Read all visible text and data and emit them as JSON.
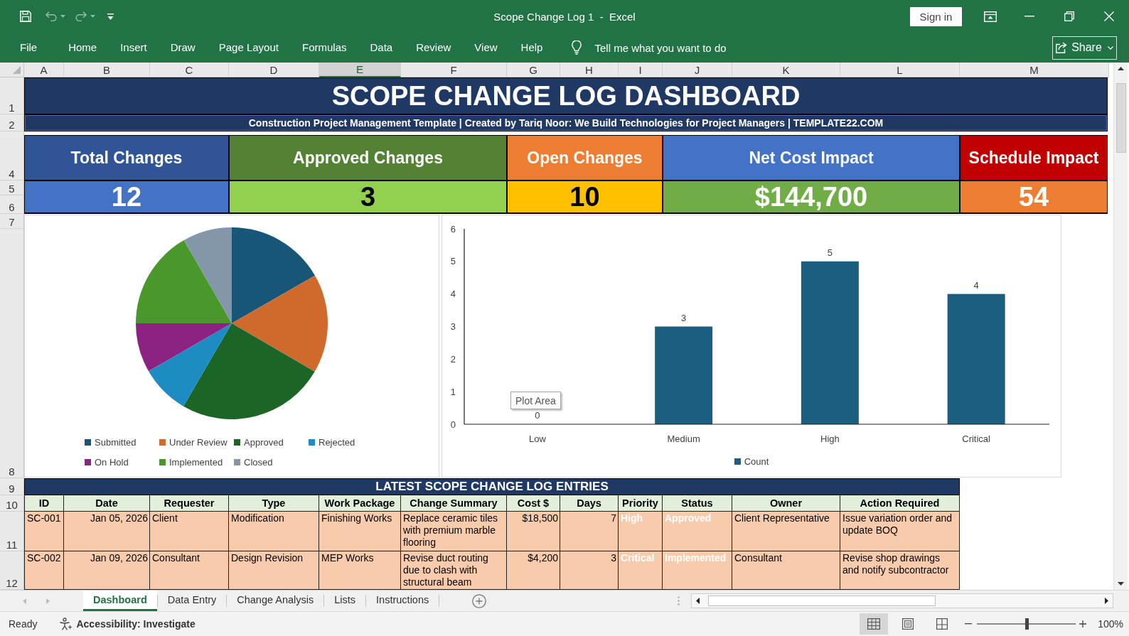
{
  "window": {
    "title": "Scope Change Log 1  -  Excel",
    "sign_in": "Sign in"
  },
  "ribbon": {
    "tabs": [
      {
        "label": "File",
        "selected": false
      },
      {
        "label": "Home",
        "selected": false
      },
      {
        "label": "Insert",
        "selected": false
      },
      {
        "label": "Draw",
        "selected": false
      },
      {
        "label": "Page Layout",
        "selected": false
      },
      {
        "label": "Formulas",
        "selected": false
      },
      {
        "label": "Data",
        "selected": false
      },
      {
        "label": "Review",
        "selected": false
      },
      {
        "label": "View",
        "selected": false
      },
      {
        "label": "Help",
        "selected": false
      }
    ],
    "tell_me": "Tell me what you want to do",
    "share": "Share"
  },
  "sheet": {
    "columns": [
      {
        "label": "A",
        "selected": false
      },
      {
        "label": "B",
        "selected": false
      },
      {
        "label": "C",
        "selected": false
      },
      {
        "label": "D",
        "selected": false
      },
      {
        "label": "E",
        "selected": true
      },
      {
        "label": "F",
        "selected": false
      },
      {
        "label": "G",
        "selected": false
      },
      {
        "label": "H",
        "selected": false
      },
      {
        "label": "I",
        "selected": false
      },
      {
        "label": "J",
        "selected": false
      },
      {
        "label": "K",
        "selected": false
      },
      {
        "label": "L",
        "selected": false
      },
      {
        "label": "M",
        "selected": false
      }
    ],
    "rows": [
      "1",
      "2",
      "4",
      "5",
      "6",
      "7",
      "8",
      "9",
      "10",
      "11",
      "12"
    ]
  },
  "header": {
    "title": "SCOPE CHANGE LOG DASHBOARD",
    "subtitle": "Construction Project Management Template | Created by Tariq Noor: We Build Technologies for Project Managers | TEMPLATE22.COM"
  },
  "kpis": [
    {
      "label": {
        "text": "Total Changes",
        "color": "#2f5597"
      },
      "value": {
        "text": "12",
        "color": "#4472c4"
      }
    },
    {
      "label": {
        "text": "Approved Changes",
        "color": "#548235"
      },
      "value": {
        "text": "3",
        "color": "#92d050"
      }
    },
    {
      "label": {
        "text": "Open Changes",
        "color": "#ed7d31"
      },
      "value": {
        "text": "10",
        "color": "#ffc000"
      }
    },
    {
      "label": {
        "text": "Net Cost Impact",
        "color": "#4472c4"
      },
      "value": {
        "text": "$144,700",
        "color": "#70ad47"
      }
    },
    {
      "label": {
        "text": "Schedule Impact",
        "color": "#c00000"
      },
      "value": {
        "text": "54",
        "color": "#ed7d31"
      }
    }
  ],
  "pie_chart": {
    "chart_data": {
      "type": "pie",
      "categories": [
        "Submitted",
        "Under Review",
        "Approved",
        "Rejected",
        "On Hold",
        "Implemented",
        "Closed"
      ],
      "values": [
        16.7,
        16.7,
        25,
        8.3,
        8.3,
        16.7,
        8.3
      ],
      "colors": [
        "#175677",
        "#d0692c",
        "#1b6526",
        "#1c8cc3",
        "#8c2383",
        "#4a982b",
        "#8496aa"
      ],
      "legend": "bottom"
    }
  },
  "bar_chart": {
    "chart_data": {
      "type": "bar",
      "categories": [
        "Low",
        "Medium",
        "High",
        "Critical"
      ],
      "series": [
        {
          "name": "Count",
          "color": "#1b5e80",
          "values": [
            0,
            3,
            5,
            4
          ]
        }
      ],
      "ylim": [
        0,
        6
      ],
      "yticks": [
        0,
        1,
        2,
        3,
        4,
        5,
        6
      ],
      "data_labels": true,
      "legend": "bottom"
    },
    "tooltip": "Plot Area"
  },
  "log_table": {
    "title": "LATEST SCOPE CHANGE LOG ENTRIES",
    "columns": [
      {
        "label": "ID",
        "kind": "text"
      },
      {
        "label": "Date",
        "kind": "number"
      },
      {
        "label": "Requester",
        "kind": "text"
      },
      {
        "label": "Type",
        "kind": "text"
      },
      {
        "label": "Work Package",
        "kind": "text"
      },
      {
        "label": "Change Summary",
        "kind": "text"
      },
      {
        "label": "Cost $",
        "kind": "number"
      },
      {
        "label": "Days",
        "kind": "number"
      },
      {
        "label": "Priority",
        "kind": "highlight"
      },
      {
        "label": "Status",
        "kind": "highlight"
      },
      {
        "label": "Owner",
        "kind": "text"
      },
      {
        "label": "Action Required",
        "kind": "text"
      }
    ],
    "rows": [
      [
        "SC-001",
        "Jan 05, 2026",
        "Client",
        "Modification",
        "Finishing Works",
        "Replace ceramic tiles with premium marble flooring",
        "$18,500",
        "7",
        "High",
        "Approved",
        "Client Representative",
        "Issue variation order and update BOQ"
      ],
      [
        "SC-002",
        "Jan 09, 2026",
        "Consultant",
        "Design Revision",
        "MEP Works",
        "Revise duct routing due to clash with structural beam",
        "$4,200",
        "3",
        "Critical",
        "Implemented",
        "Consultant",
        "Revise shop drawings and notify subcontractor"
      ]
    ]
  },
  "sheet_tabs": [
    {
      "label": "Dashboard",
      "selected": true
    },
    {
      "label": "Data Entry",
      "selected": false
    },
    {
      "label": "Change Analysis",
      "selected": false
    },
    {
      "label": "Lists",
      "selected": false
    },
    {
      "label": "Instructions",
      "selected": false
    }
  ],
  "status_bar": {
    "mode": "Ready",
    "accessibility": "Accessibility: Investigate",
    "views": [
      {
        "kind": "normal",
        "selected": true
      },
      {
        "kind": "page_layout",
        "selected": false
      },
      {
        "kind": "page_break",
        "selected": false
      }
    ],
    "zoom": {
      "level": 0.5,
      "label": "100%"
    }
  }
}
